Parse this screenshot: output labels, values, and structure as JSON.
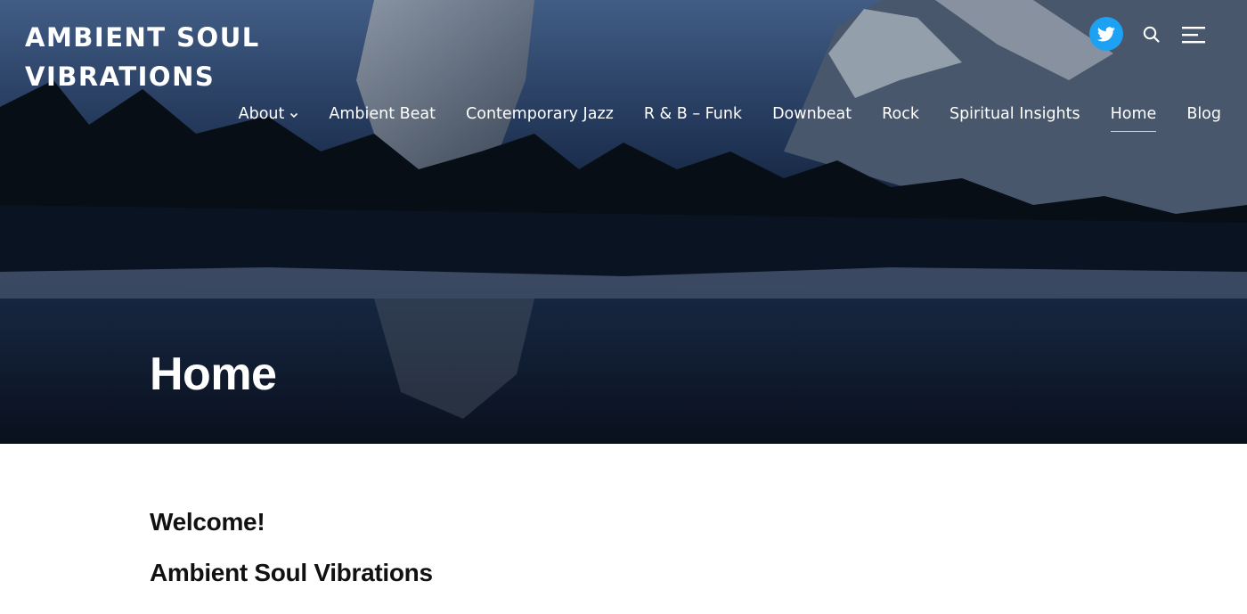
{
  "site": {
    "title": "AMBIENT SOUL VIBRATIONS"
  },
  "header": {
    "social": {
      "icon": "twitter-icon",
      "color": "#1da1f2"
    },
    "search_icon": "search-icon",
    "menu_icon": "menu-icon"
  },
  "nav": {
    "items": [
      {
        "label": "About",
        "has_dropdown": true
      },
      {
        "label": "Ambient Beat"
      },
      {
        "label": "Contemporary Jazz"
      },
      {
        "label": "R & B – Funk"
      },
      {
        "label": "Downbeat"
      },
      {
        "label": "Rock"
      },
      {
        "label": "Spiritual Insights"
      },
      {
        "label": "Home",
        "active": true
      },
      {
        "label": "Blog"
      }
    ]
  },
  "hero": {
    "page_title": "Home"
  },
  "content": {
    "heading_1": "Welcome!",
    "heading_2": "Ambient Soul Vibrations"
  }
}
